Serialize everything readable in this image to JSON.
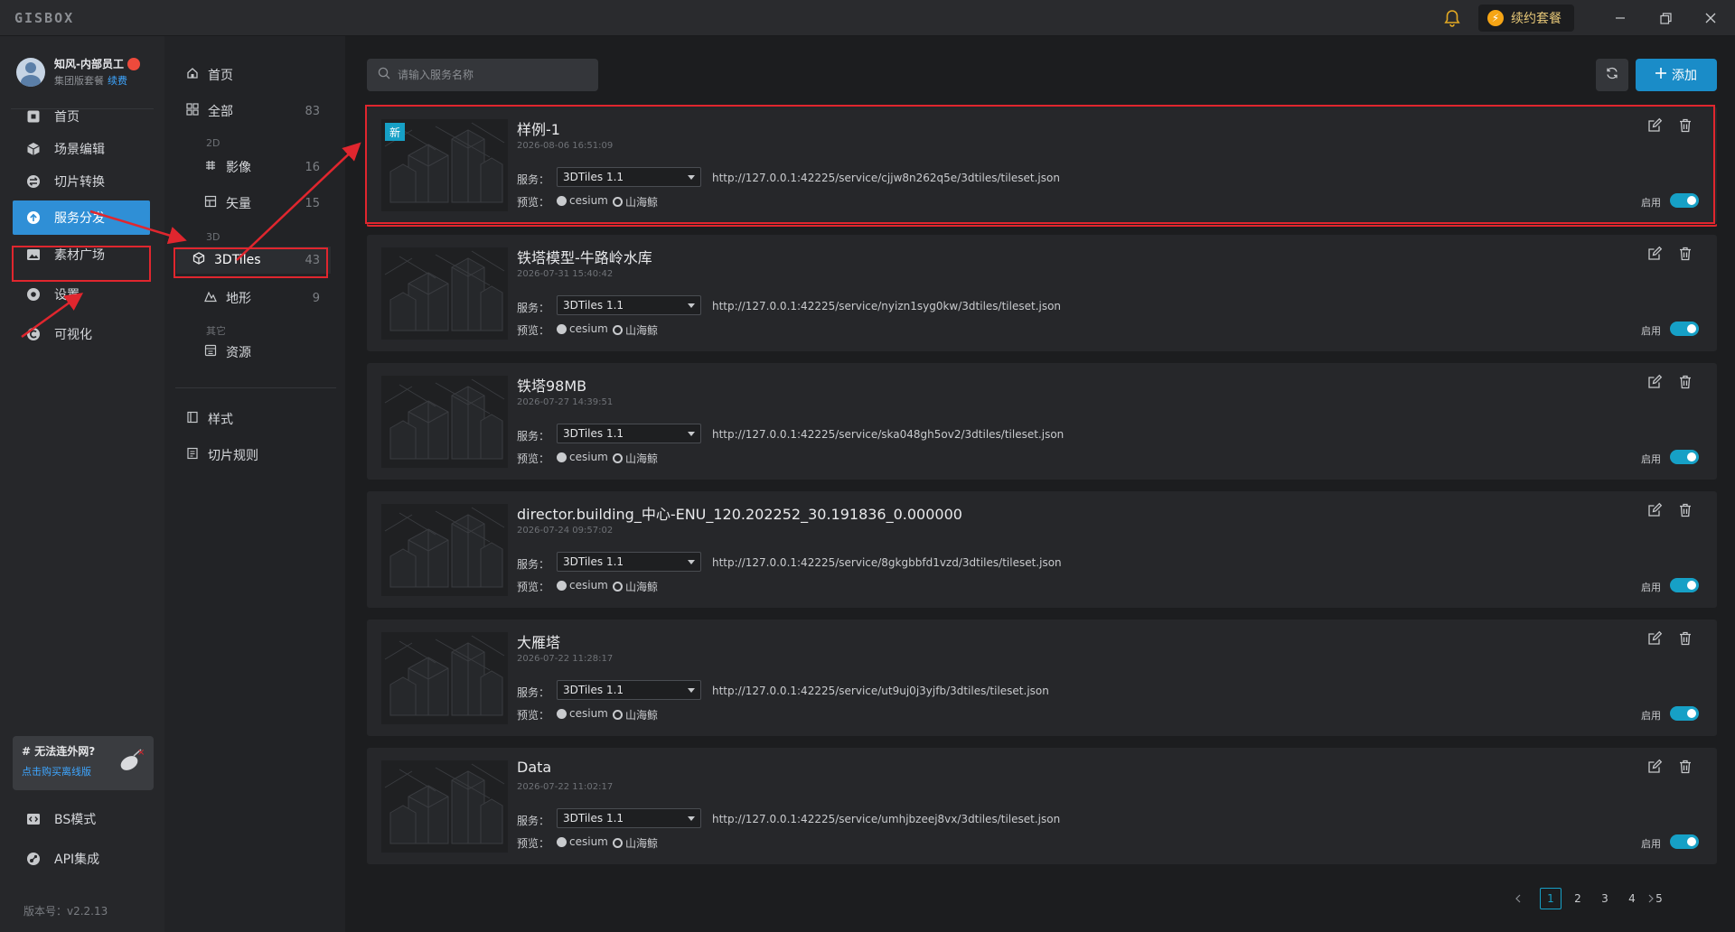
{
  "titlebar": {
    "logo": "GISBOX",
    "plan_button": "续约套餐"
  },
  "user": {
    "name": "知风-内部员工",
    "plan": "集团版套餐",
    "renew": "续费"
  },
  "sidebar": {
    "items": [
      {
        "label": "首页",
        "icon": "home-icon"
      },
      {
        "label": "场景编辑",
        "icon": "cube-icon"
      },
      {
        "label": "切片转换",
        "icon": "convert-icon"
      },
      {
        "label": "服务分发",
        "icon": "upload-icon",
        "active": true
      },
      {
        "label": "素材广场",
        "icon": "image-icon"
      },
      {
        "label": "设置",
        "icon": "gear-icon"
      },
      {
        "label": "可视化",
        "icon": "chart-icon"
      }
    ],
    "promo": {
      "title": "# 无法连外网?",
      "link": "点击购买离线版"
    },
    "bottom_items": [
      {
        "label": "BS模式",
        "icon": "code-icon"
      },
      {
        "label": "API集成",
        "icon": "api-icon"
      }
    ],
    "version": "版本号：v2.2.13"
  },
  "panel2": {
    "home": "首页",
    "all": {
      "label": "全部",
      "count": "83"
    },
    "group_2d": "2D",
    "imagery": {
      "label": "影像",
      "count": "16"
    },
    "vector": {
      "label": "矢量",
      "count": "15"
    },
    "group_3d": "3D",
    "tiles3d": {
      "label": "3DTiles",
      "count": "43"
    },
    "terrain": {
      "label": "地形",
      "count": "9"
    },
    "group_other": "其它",
    "resource": {
      "label": "资源"
    },
    "style": "样式",
    "tile_rules": "切片规则"
  },
  "toolbar": {
    "search_placeholder": "请输入服务名称",
    "add_label": "添加"
  },
  "labels": {
    "service": "服务：",
    "preview": "预览：",
    "cesium": "cesium",
    "shanhai": "山海鲸",
    "enable": "启用",
    "new_tag": "新"
  },
  "services": [
    {
      "title": "样例-1",
      "date": "2026-08-06 16:51:09",
      "version": "3DTiles 1.1",
      "url": "http://127.0.0.1:42225/service/cjjw8n262q5e/3dtiles/tileset.json",
      "enabled": true,
      "is_new": true
    },
    {
      "title": "铁塔模型-牛路岭水库",
      "date": "2026-07-31 15:40:42",
      "version": "3DTiles 1.1",
      "url": "http://127.0.0.1:42225/service/nyizn1syg0kw/3dtiles/tileset.json",
      "enabled": true
    },
    {
      "title": "铁塔98MB",
      "date": "2026-07-27 14:39:51",
      "version": "3DTiles 1.1",
      "url": "http://127.0.0.1:42225/service/ska048gh5ov2/3dtiles/tileset.json",
      "enabled": true
    },
    {
      "title": "director.building_中心-ENU_120.202252_30.191836_0.000000",
      "date": "2026-07-24 09:57:02",
      "version": "3DTiles 1.1",
      "url": "http://127.0.0.1:42225/service/8gkgbbfd1vzd/3dtiles/tileset.json",
      "enabled": true
    },
    {
      "title": "大雁塔",
      "date": "2026-07-22 11:28:17",
      "version": "3DTiles 1.1",
      "url": "http://127.0.0.1:42225/service/ut9uj0j3yjfb/3dtiles/tileset.json",
      "enabled": true
    },
    {
      "title": "Data",
      "date": "2026-07-22 11:02:17",
      "version": "3DTiles 1.1",
      "url": "http://127.0.0.1:42225/service/umhjbzeej8vx/3dtiles/tileset.json",
      "enabled": true
    }
  ],
  "pagination": {
    "pages": [
      "1",
      "2",
      "3",
      "4",
      "5"
    ],
    "current": "1"
  },
  "colors": {
    "accent": "#16a0c6",
    "active_nav": "#2f8fd6",
    "annotation": "#e0262e"
  }
}
